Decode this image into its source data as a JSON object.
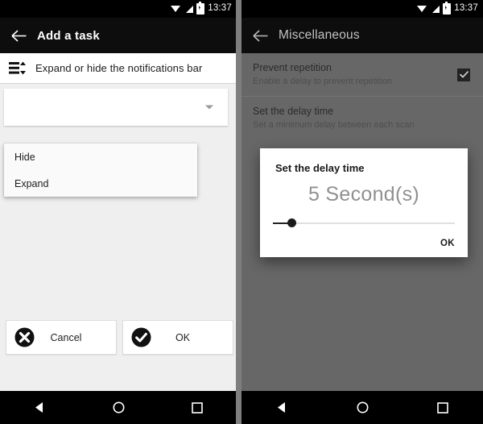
{
  "left_phone": {
    "status_bar": {
      "time": "13:37",
      "icons": [
        "wifi-icon",
        "signal-icon",
        "battery-icon"
      ]
    },
    "app_bar": {
      "back": "back-arrow-icon",
      "title": "Add a task"
    },
    "header_card": {
      "icon": "expand-collapse-bar-icon",
      "label": "Expand or hide the notifications bar"
    },
    "spinner": {
      "caret": "chevron-down-icon"
    },
    "dropdown": {
      "items": [
        {
          "label": "Hide"
        },
        {
          "label": "Expand"
        }
      ]
    },
    "actions": {
      "cancel": {
        "label": "Cancel",
        "icon": "cancel-circle-icon"
      },
      "ok": {
        "label": "OK",
        "icon": "check-circle-icon"
      }
    },
    "nav_bar": {
      "back": "nav-back-icon",
      "home": "nav-home-icon",
      "recents": "nav-recents-icon"
    }
  },
  "right_phone": {
    "status_bar": {
      "time": "13:37",
      "icons": [
        "wifi-icon",
        "signal-icon",
        "battery-icon"
      ]
    },
    "app_bar": {
      "back": "back-arrow-icon",
      "title": "Miscellaneous"
    },
    "preferences": [
      {
        "title": "Prevent repetition",
        "summary": "Enable a delay to prevent repetition",
        "checkbox": {
          "checked": true,
          "glyph": "✔"
        }
      },
      {
        "title": "Set the delay time",
        "summary": "Set a minimum delay between each scan",
        "checkbox": null
      }
    ],
    "dialog": {
      "title": "Set the delay time",
      "value": "5 Second(s)",
      "slider_percent": 10,
      "ok_label": "OK"
    },
    "nav_bar": {
      "back": "nav-back-icon",
      "home": "nav-home-icon",
      "recents": "nav-recents-icon"
    }
  },
  "colors": {
    "app_bar": "#0d0d0d",
    "screen_bg": "#efefef",
    "scrim": "#676767",
    "accent_dark": "#1b1b1b",
    "value_text": "#909090"
  }
}
